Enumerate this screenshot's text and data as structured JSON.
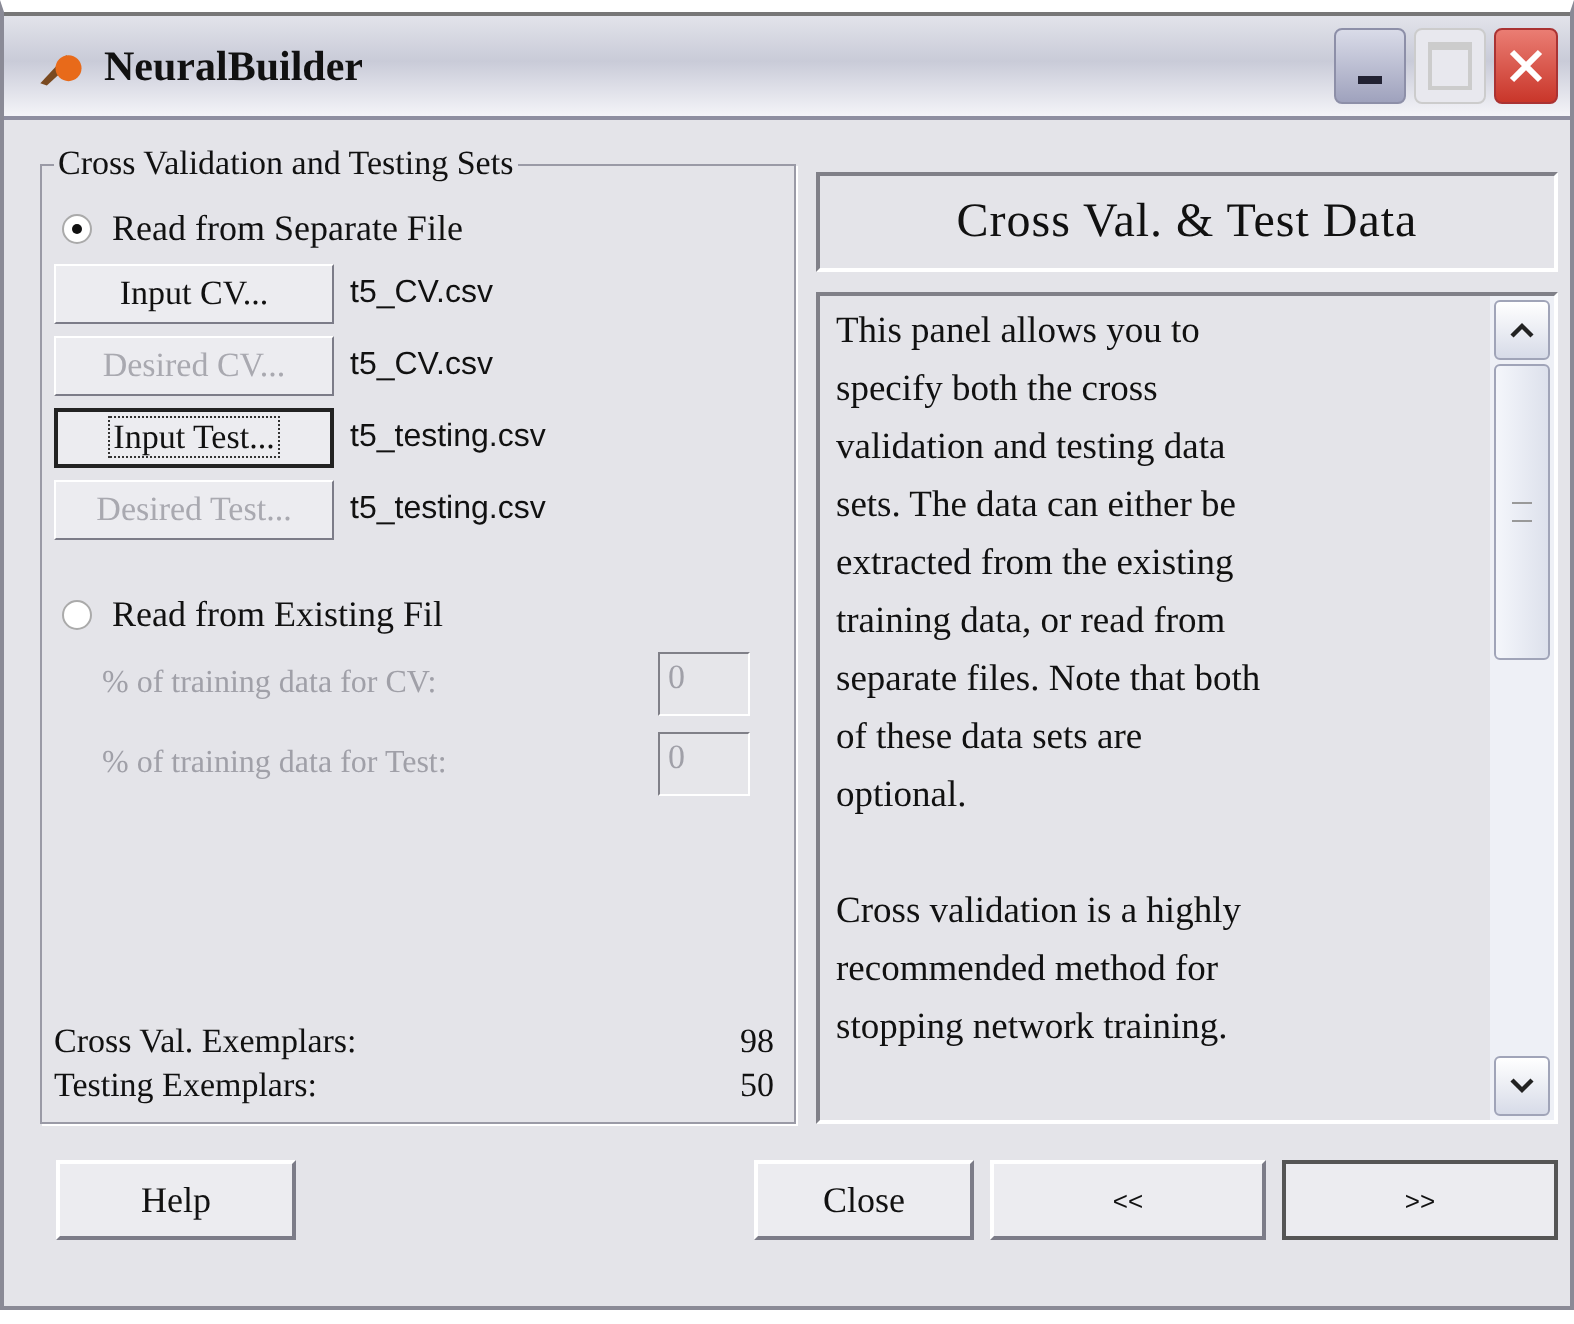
{
  "window": {
    "title": "NeuralBuilder"
  },
  "group": {
    "legend": "Cross Validation and Testing Sets"
  },
  "sources": [
    {
      "label": "Read from Separate File",
      "selected": true,
      "kind": "files"
    },
    {
      "label": "Read from Existing Fil",
      "selected": false,
      "kind": "percent"
    }
  ],
  "file_rows": [
    {
      "button": "Input CV...",
      "disabled": false,
      "focused": false,
      "file": "t5_CV.csv"
    },
    {
      "button": "Desired CV...",
      "disabled": true,
      "focused": false,
      "file": "t5_CV.csv"
    },
    {
      "button": "Input Test...",
      "disabled": false,
      "focused": true,
      "file": "t5_testing.csv"
    },
    {
      "button": "Desired Test...",
      "disabled": true,
      "focused": false,
      "file": "t5_testing.csv"
    }
  ],
  "percent_fields": [
    {
      "label": "% of training data for CV:",
      "value": "0",
      "disabled": true
    },
    {
      "label": "% of training data for Test:",
      "value": "0",
      "disabled": true
    }
  ],
  "counts": [
    {
      "label": "Cross Val. Exemplars:",
      "value": "98"
    },
    {
      "label": "Testing Exemplars:",
      "value": "50"
    }
  ],
  "panel": {
    "title": "Cross Val. & Test Data",
    "paragraphs": [
      [
        "This panel allows you to",
        "specify both the cross",
        "validation and testing data",
        "sets. The data can either be",
        "extracted from the existing",
        "training data, or read from",
        "separate files. Note that both",
        "of these data sets are",
        "optional."
      ],
      [
        "Cross validation is a highly",
        "recommended method for",
        "stopping network training."
      ]
    ]
  },
  "buttons": [
    {
      "label": "Help",
      "kind": "help"
    },
    {
      "label": "Close",
      "kind": "nav"
    },
    {
      "label": "<<",
      "kind": "nav"
    },
    {
      "label": ">>",
      "kind": "nav"
    }
  ]
}
